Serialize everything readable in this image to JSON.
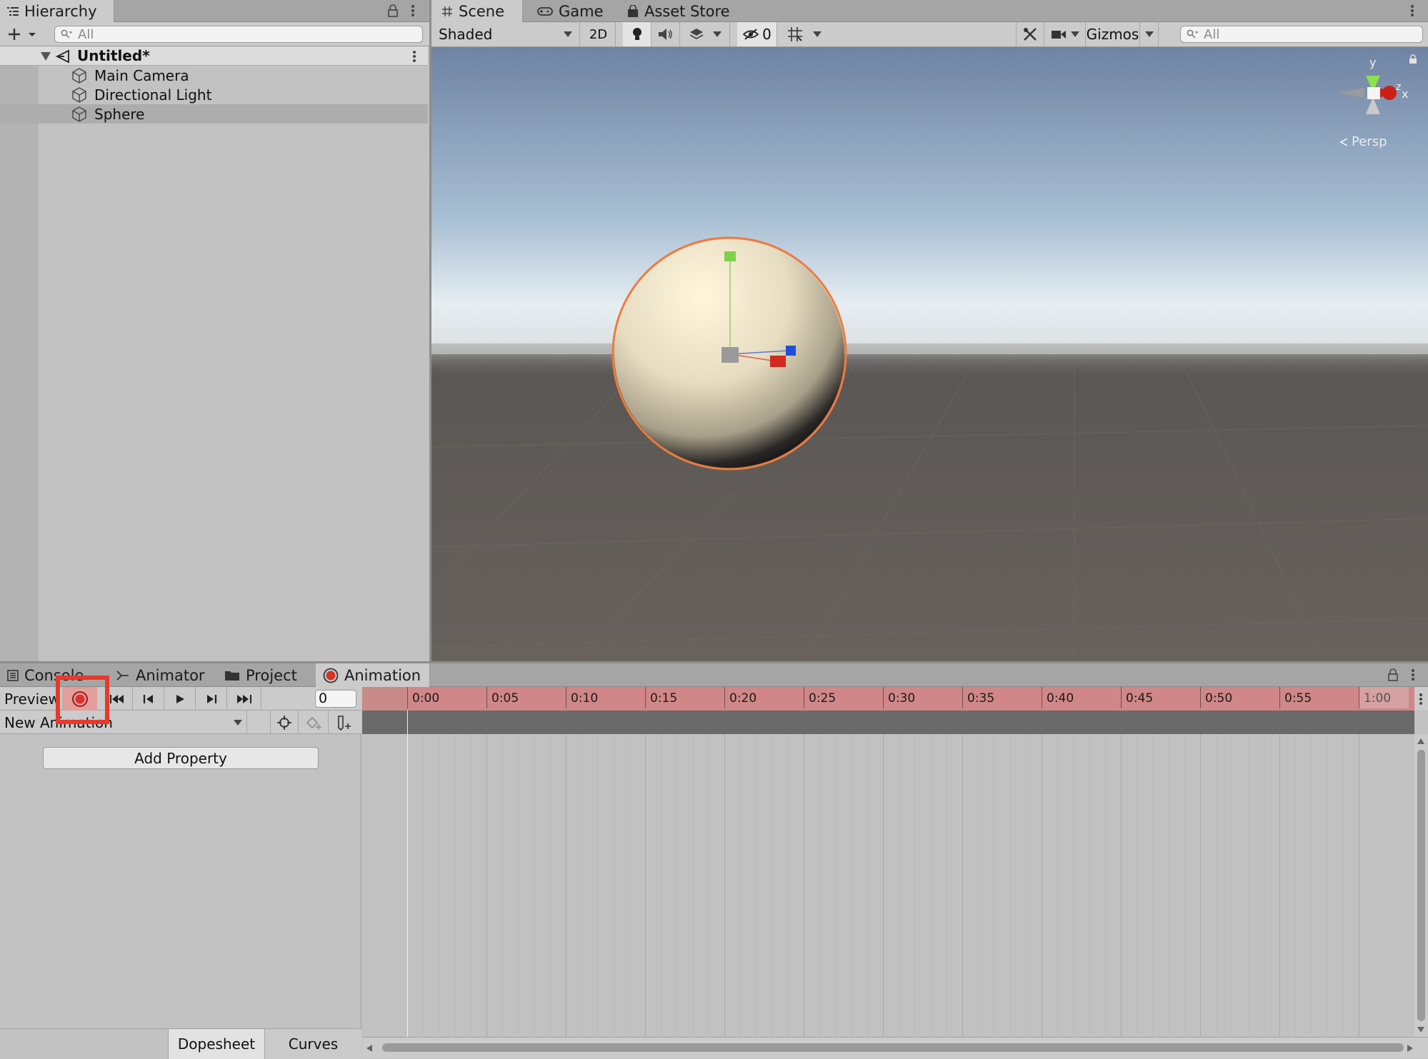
{
  "hierarchy": {
    "tab_label": "Hierarchy",
    "search_placeholder": "All",
    "scene_name": "Untitled*",
    "items": [
      {
        "label": "Main Camera"
      },
      {
        "label": "Directional Light"
      },
      {
        "label": "Sphere"
      }
    ]
  },
  "scene_tabs": {
    "scene": "Scene",
    "game": "Game",
    "asset_store": "Asset Store"
  },
  "scene_toolbar": {
    "shading_mode": "Shaded",
    "toggle_2d": "2D",
    "hidden_count": "0",
    "gizmos_label": "Gizmos",
    "search_placeholder": "All"
  },
  "scene_view": {
    "projection_label": "Persp",
    "axis_y": "y",
    "axis_x": "x",
    "axis_z": "z"
  },
  "bottom_tabs": {
    "console": "Console",
    "animator": "Animator",
    "project": "Project",
    "animation": "Animation"
  },
  "animation": {
    "preview_label": "Preview",
    "frame_value": "0",
    "clip_name": "New Animation",
    "add_property": "Add Property",
    "dopesheet": "Dopesheet",
    "curves": "Curves",
    "ticks": [
      "0:00",
      "0:05",
      "0:10",
      "0:15",
      "0:20",
      "0:25",
      "0:30",
      "0:35",
      "0:40",
      "0:45",
      "0:50",
      "0:55",
      "1:00"
    ]
  },
  "colors": {
    "record_red": "#d9342b",
    "highlight_box": "#e8392b",
    "timeline_record_tint": "#d18787",
    "selection_outline": "#f07a3c"
  }
}
